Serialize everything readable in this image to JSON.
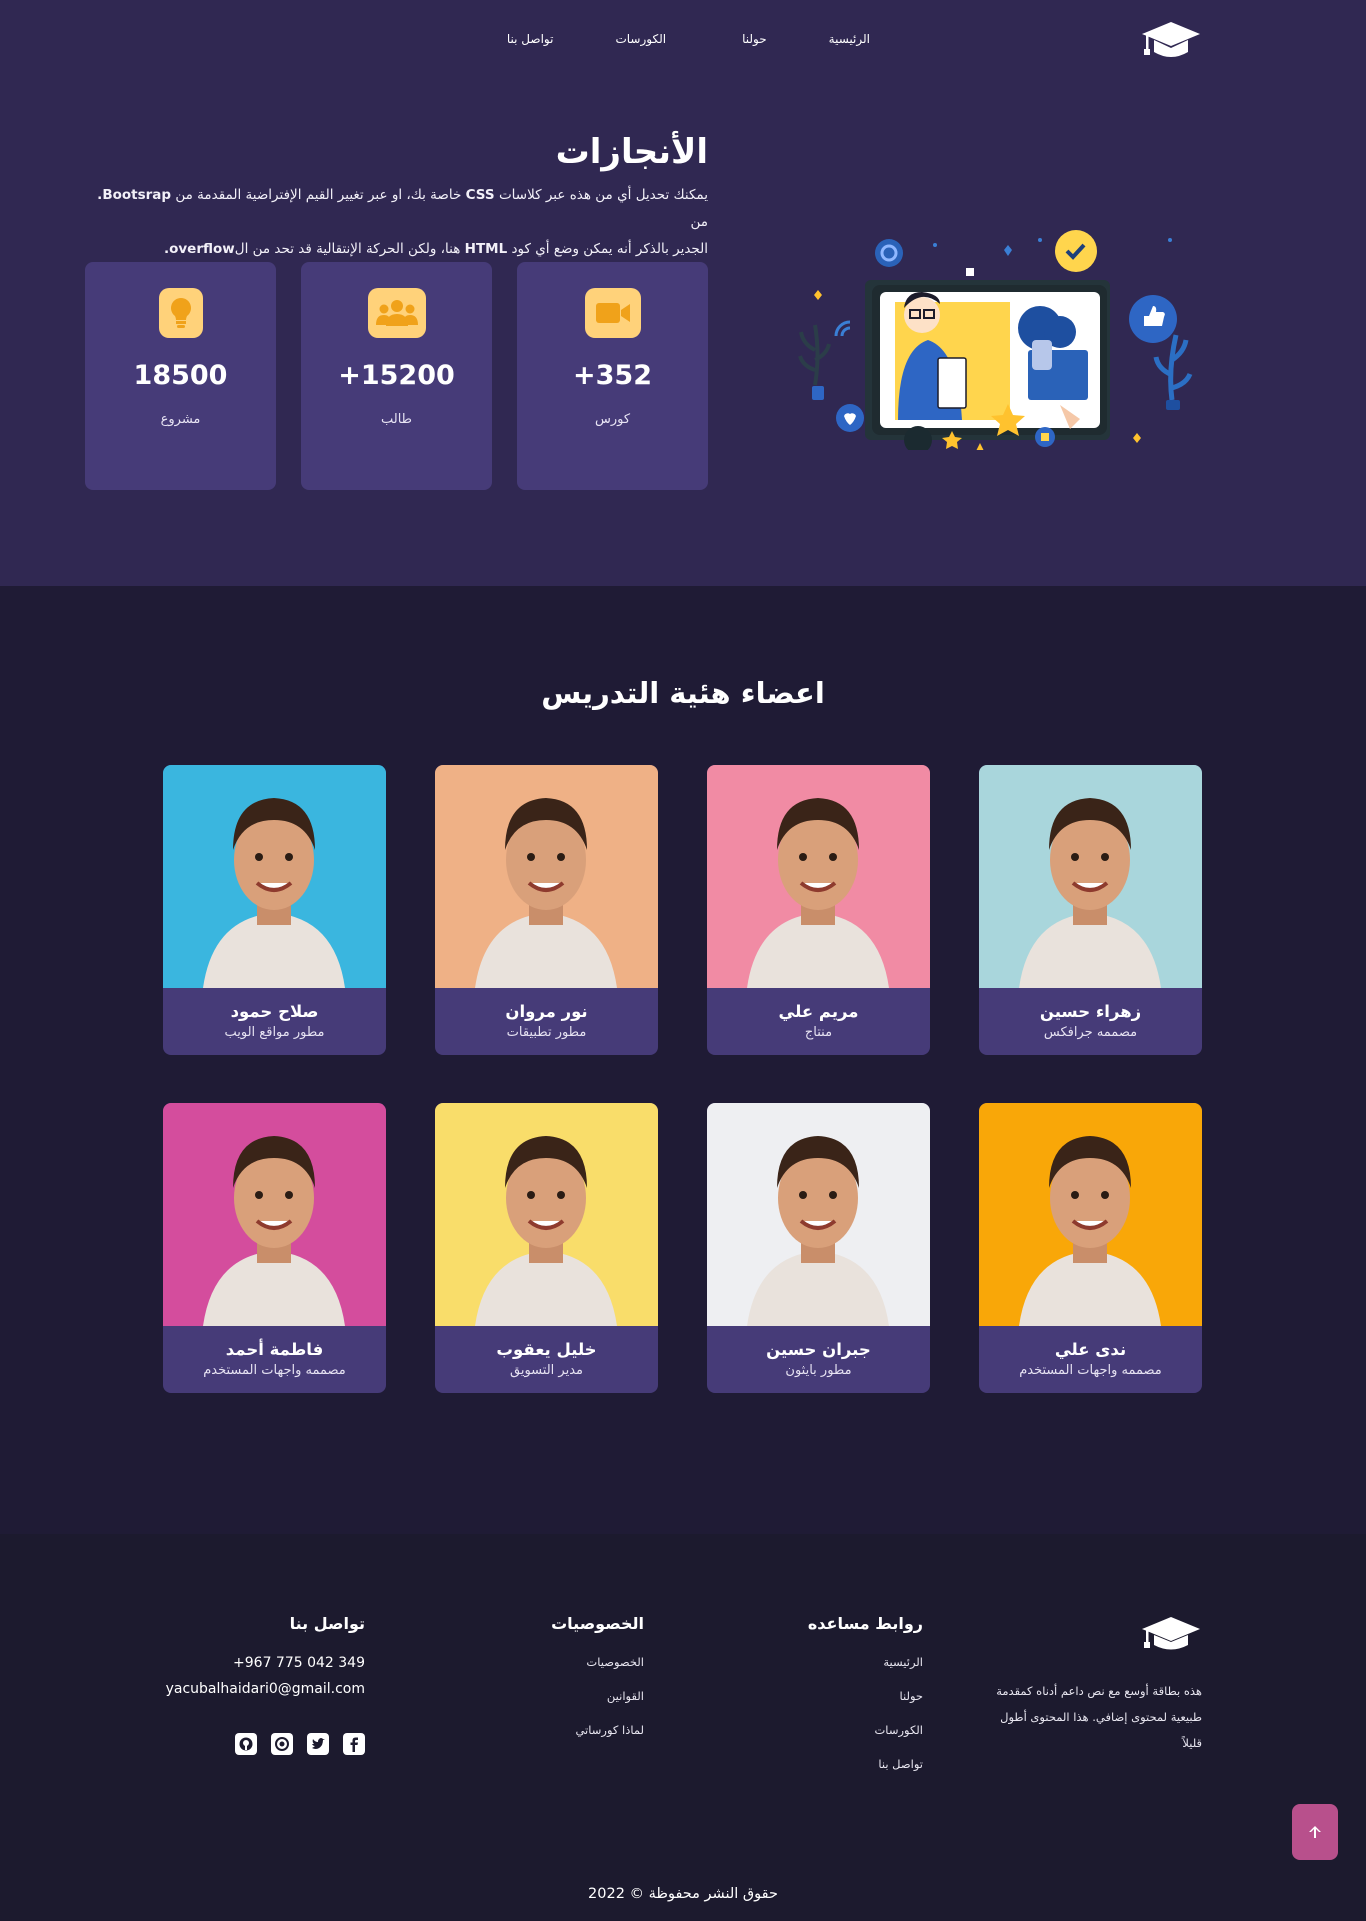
{
  "nav": {
    "logo_icon": "graduation-cap-icon",
    "links": [
      "الرئيسية",
      "حولنا",
      "الكورسات",
      "تواصل بنا"
    ]
  },
  "achievements": {
    "title": "الأنجازات",
    "description_line1_a": "يمكنك تحديل أي من هذه عبر كلاسات",
    "description_line1_b": "CSS",
    "description_line1_c": "خاصة بك، او عبر تغيير القيم الإفتراضية المقدمة من",
    "description_line1_d": "Bootsrap.",
    "description_line1_e": "من",
    "description_line2_a": "الجدير بالذكر أنه يمكن وضع أي كود",
    "description_line2_b": "HTML",
    "description_line2_c": "هنا، ولكن الحركة الإنتقالية قد تحد من ال",
    "description_line2_d": "overflow.",
    "stats": [
      {
        "icon": "video-camera-icon",
        "value": "+352",
        "label": "كورس"
      },
      {
        "icon": "users-group-icon",
        "value": "+15200",
        "label": "طالب"
      },
      {
        "icon": "lightbulb-icon",
        "value": "18500",
        "label": "مشروع"
      }
    ],
    "illustration": "online-teacher-illustration"
  },
  "team": {
    "title": "اعضاء هئية التدريس",
    "members": [
      {
        "name": "زهراء حسين",
        "role": "مصممه جرافكس",
        "bg": "#a9d6dc"
      },
      {
        "name": "مريم علي",
        "role": "منتاج",
        "bg": "#f18ba4"
      },
      {
        "name": "نور مروان",
        "role": "مطور تطبيقات",
        "bg": "#efb186"
      },
      {
        "name": "صلاح حمود",
        "role": "مطور مواقع الويب",
        "bg": "#3ab6df"
      },
      {
        "name": "ندى علي",
        "role": "مصممه واجهات المستخدم",
        "bg": "#f9a708"
      },
      {
        "name": "جبران حسين",
        "role": "مطور بايثون",
        "bg": "#eeeff2"
      },
      {
        "name": "خليل يعقوب",
        "role": "مدير التسويق",
        "bg": "#f9dd6a"
      },
      {
        "name": "فاطمة أحمد",
        "role": "مصممه واجهات المستخدم",
        "bg": "#d44d9d"
      }
    ]
  },
  "footer": {
    "brand_text": "هذه بطاقة أوسع مع نص داعم أدناه كمقدمة طبيعية لمحتوى إضافي. هذا المحتوى أطول قليلاً",
    "links_title": "روابط مساعده",
    "links": [
      "الرئيسية",
      "حولنا",
      "الكورسات",
      "تواصل بنا"
    ],
    "privacy_title": "الخصوصيات",
    "privacy": [
      "الخصوصيات",
      "القوانين",
      "لماذا كورساتي"
    ],
    "contact_title": "تواصل بنا",
    "phone": "+967 775 042 349",
    "email": "yacubalhaidari0@gmail.com",
    "socials": [
      "facebook-icon",
      "twitter-icon",
      "whatsapp-icon",
      "github-icon"
    ],
    "copyright": "حقوق النشر محفوظة © 2022",
    "scroll_top_icon": "arrow-up-icon"
  }
}
